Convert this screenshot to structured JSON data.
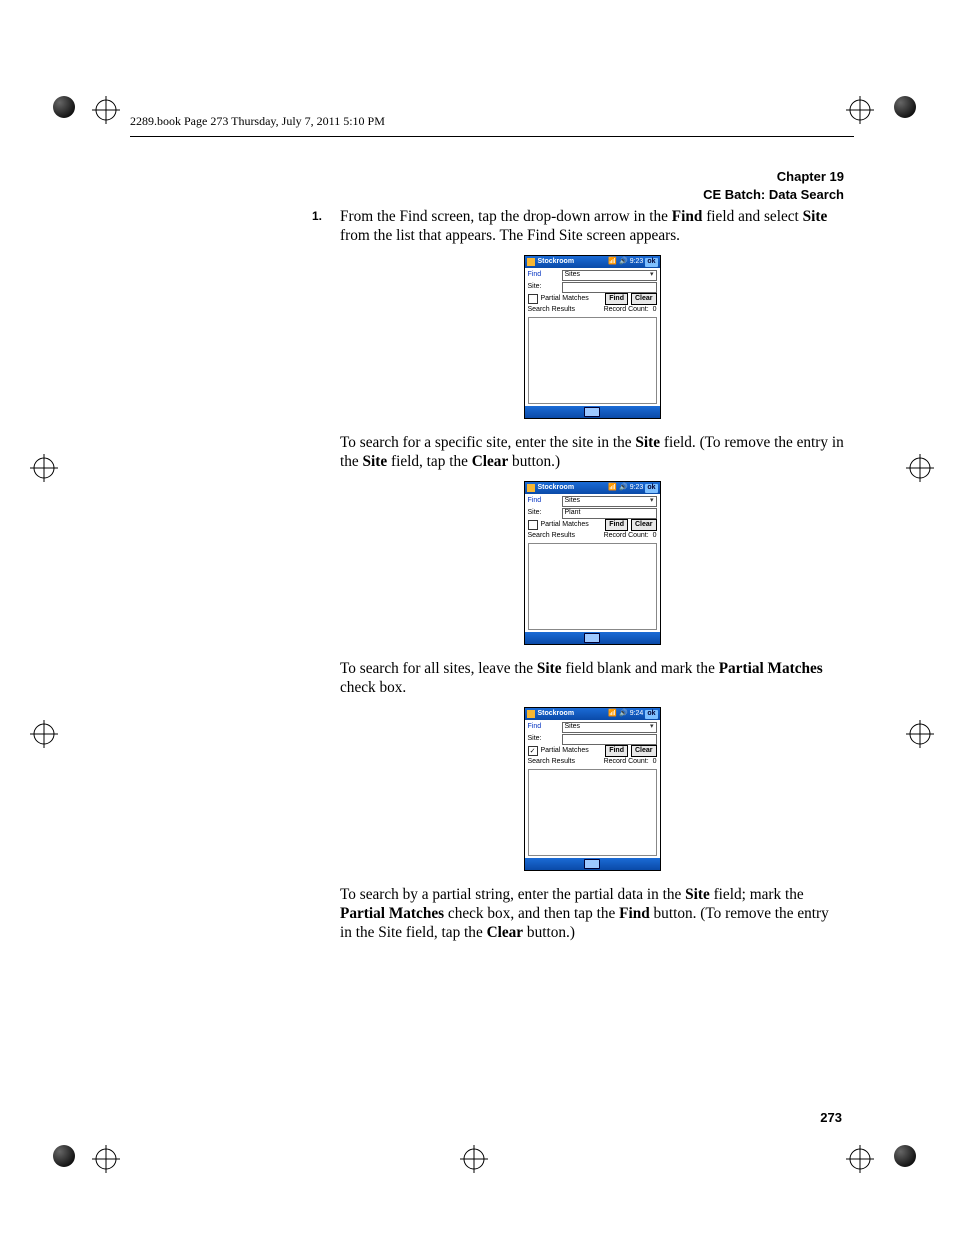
{
  "header_line": "2289.book  Page 273  Thursday, July 7, 2011  5:10 PM",
  "chapter": {
    "title": "Chapter 19",
    "subtitle": "CE Batch: Data Search"
  },
  "step_number": "1.",
  "paragraphs": {
    "p1a": "From the Find screen, tap the drop-down arrow in the ",
    "p1b": "Find",
    "p1c": " field and select ",
    "p1d": "Site",
    "p1e": " from the list that appears. The Find Site screen appears.",
    "p2a": "To search for a specific site, enter the site in the ",
    "p2b": "Site",
    "p2c": " field. (To remove the entry in the ",
    "p2d": "Site",
    "p2e": " field, tap the ",
    "p2f": "Clear",
    "p2g": " button.)",
    "p3a": "To search for all sites, leave the ",
    "p3b": "Site",
    "p3c": " field blank and mark the ",
    "p3d": "Partial Matches",
    "p3e": " check box.",
    "p4a": "To search by a partial string, enter the partial data in the ",
    "p4b": "Site",
    "p4c": " field; mark the ",
    "p4d": "Partial Matches",
    "p4e": " check box, and then tap the ",
    "p4f": "Find",
    "p4g": " button. (To remove the entry in the Site field, tap the ",
    "p4h": "Clear",
    "p4i": " button.)"
  },
  "pda": {
    "title": "Stockroom",
    "time1": "9:23",
    "time3": "9:24",
    "ok": "ok",
    "find_label": "Find",
    "find_value": "Sites",
    "site_label": "Site:",
    "site_value1": "",
    "site_value2": "Plant",
    "site_value3": "",
    "partial_label": "Partial Matches",
    "find_btn": "Find",
    "clear_btn": "Clear",
    "results_label": "Search Results",
    "record_count_label": "Record Count:",
    "record_count_value": "0",
    "checkmark": "✓"
  },
  "page_number": "273"
}
